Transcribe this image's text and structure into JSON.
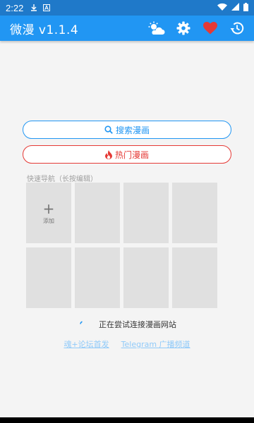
{
  "status_bar": {
    "time": "2:22",
    "icons": [
      "download-icon",
      "a-box-icon",
      "wifi-icon",
      "signal-icon",
      "battery-icon"
    ]
  },
  "app_bar": {
    "title": "微漫 v1.1.4",
    "actions": [
      "weather-icon",
      "settings-icon",
      "favorite-icon",
      "history-icon"
    ],
    "favorite_color": "#e53935"
  },
  "main": {
    "search_button": "搜索漫画",
    "hot_button": "热门漫画",
    "quick_nav_label": "快速导航（长按编辑）",
    "tiles": [
      {
        "type": "add",
        "plus": "+",
        "label": "添加"
      },
      {
        "type": "empty"
      },
      {
        "type": "empty"
      },
      {
        "type": "empty"
      },
      {
        "type": "empty"
      },
      {
        "type": "empty"
      },
      {
        "type": "empty"
      },
      {
        "type": "empty"
      }
    ],
    "loading_text": "正在尝试连接漫画网站",
    "links": [
      "魂+论坛首发",
      "Telegram 广播频道"
    ]
  },
  "colors": {
    "primary": "#2196f3",
    "status_bar": "#1f79c9",
    "hot": "#e53935",
    "link": "#90caf9"
  }
}
